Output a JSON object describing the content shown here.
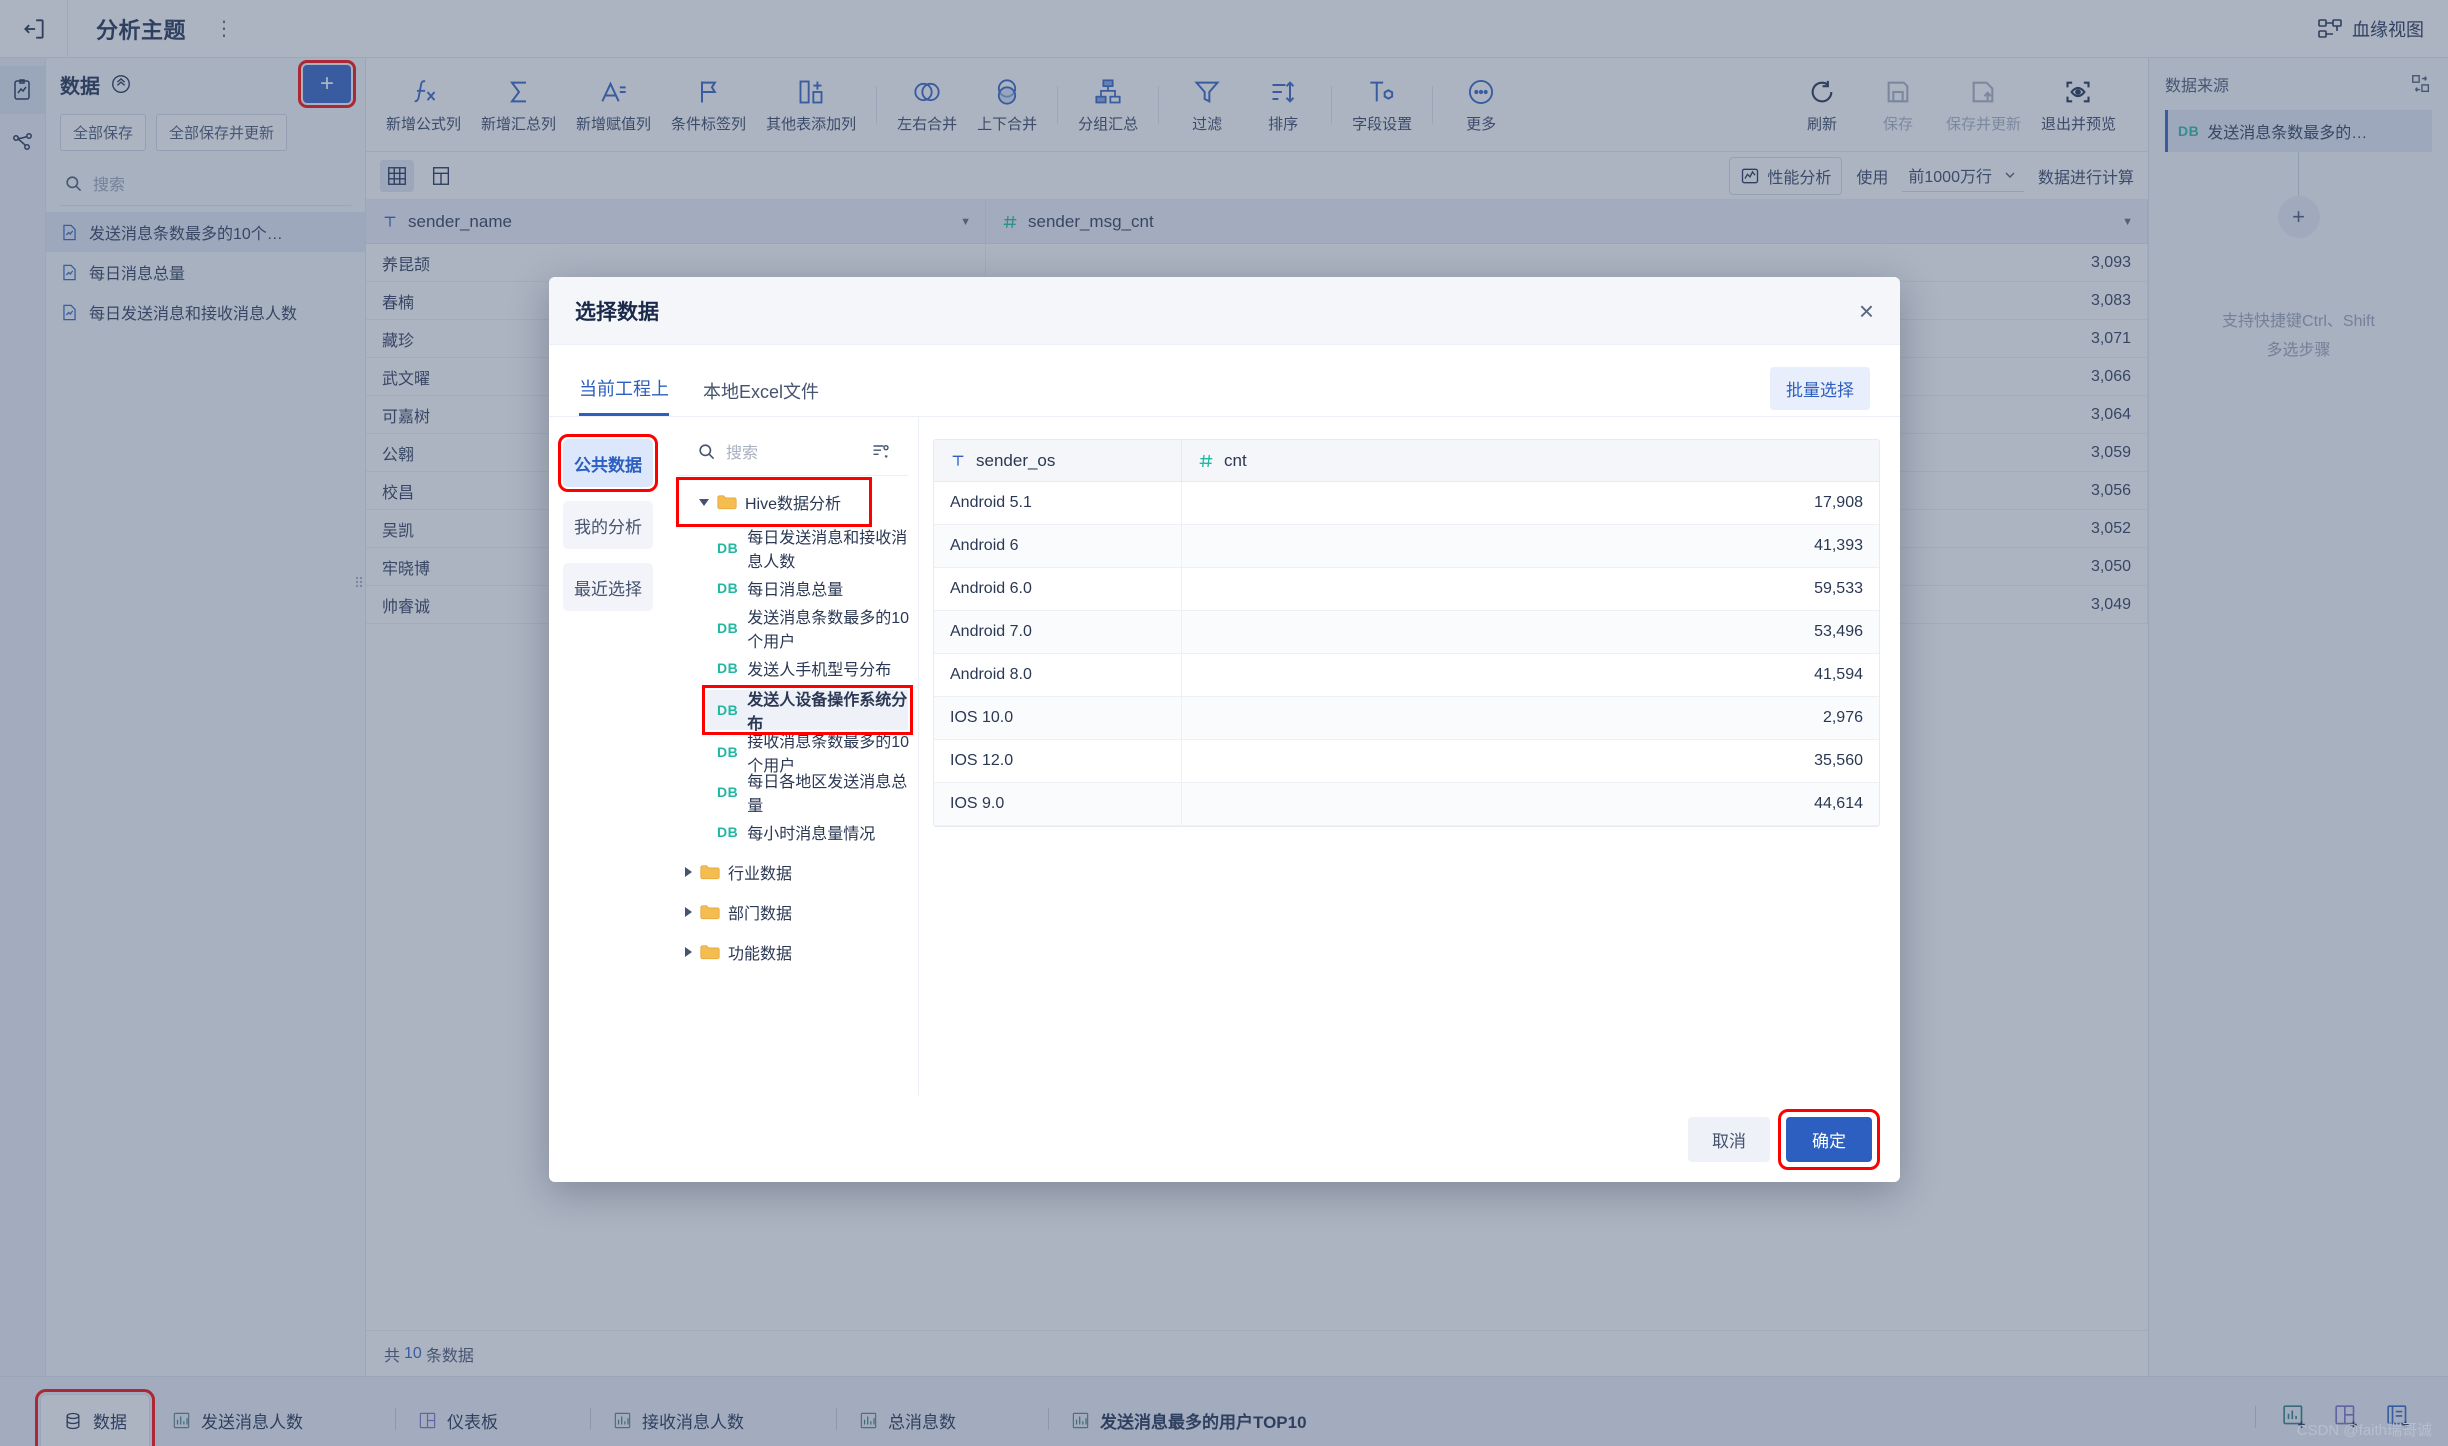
{
  "titlebar": {
    "back_icon": "exit-arrow-icon",
    "title": "分析主题",
    "more_icon": "vertical-dots-icon",
    "lineage_icon": "lineage-icon",
    "lineage_label": "血缘视图"
  },
  "rail": {
    "items": [
      {
        "name": "clipboard-analysis-icon",
        "active": true
      },
      {
        "name": "flow-nodes-icon",
        "active": false
      }
    ]
  },
  "left_panel": {
    "title": "数据",
    "collapse_icon": "collapse-up-icon",
    "add_label": "+",
    "buttons": [
      "全部保存",
      "全部保存并更新"
    ],
    "search_placeholder": "搜索",
    "items": [
      {
        "label": "发送消息条数最多的10个…",
        "active": true
      },
      {
        "label": "每日消息总量",
        "active": false
      },
      {
        "label": "每日发送消息和接收消息人数",
        "active": false
      }
    ]
  },
  "toolbar": {
    "groups": [
      [
        {
          "icon": "formula-column-icon",
          "label": "新增公式列"
        },
        {
          "icon": "sum-column-icon",
          "label": "新增汇总列"
        },
        {
          "icon": "assign-column-icon",
          "label": "新增赋值列"
        },
        {
          "icon": "condition-flag-icon",
          "label": "条件标签列"
        },
        {
          "icon": "other-table-column-icon",
          "label": "其他表添加列"
        }
      ],
      [
        {
          "icon": "merge-horizontal-icon",
          "label": "左右合并"
        },
        {
          "icon": "merge-vertical-icon",
          "label": "上下合并"
        }
      ],
      [
        {
          "icon": "group-aggregate-icon",
          "label": "分组汇总"
        }
      ],
      [
        {
          "icon": "filter-icon",
          "label": "过滤"
        },
        {
          "icon": "sort-icon",
          "label": "排序"
        }
      ],
      [
        {
          "icon": "field-settings-icon",
          "label": "字段设置"
        }
      ],
      [
        {
          "icon": "more-icon",
          "label": "更多"
        }
      ]
    ],
    "right_actions": [
      {
        "icon": "refresh-icon",
        "label": "刷新",
        "disabled": false
      },
      {
        "icon": "save-icon",
        "label": "保存",
        "disabled": true
      },
      {
        "icon": "save-update-icon",
        "label": "保存并更新",
        "disabled": true
      },
      {
        "icon": "exit-preview-icon",
        "label": "退出并预览",
        "disabled": false
      }
    ]
  },
  "subbar": {
    "view_grid_icon": "grid-view-icon",
    "view_split_icon": "split-view-icon",
    "perf_icon": "performance-icon",
    "perf_label": "性能分析",
    "use_label": "使用",
    "rows_value": "前1000万行",
    "rows_caret": "chevron-down-icon",
    "calc_label": "数据进行计算"
  },
  "grid": {
    "columns": [
      {
        "type_icon": "text-type-icon",
        "name": "sender_name"
      },
      {
        "type_icon": "number-type-icon",
        "name": "sender_msg_cnt"
      }
    ],
    "rows": [
      {
        "sender_name": "养昆颉",
        "sender_msg_cnt": "3,093"
      },
      {
        "sender_name": "春楠",
        "sender_msg_cnt": "3,083"
      },
      {
        "sender_name": "藏珍",
        "sender_msg_cnt": "3,071"
      },
      {
        "sender_name": "武文曜",
        "sender_msg_cnt": "3,066"
      },
      {
        "sender_name": "可嘉树",
        "sender_msg_cnt": "3,064"
      },
      {
        "sender_name": "公翱",
        "sender_msg_cnt": "3,059"
      },
      {
        "sender_name": "校昌",
        "sender_msg_cnt": "3,056"
      },
      {
        "sender_name": "吴凯",
        "sender_msg_cnt": "3,052"
      },
      {
        "sender_name": "牢晓博",
        "sender_msg_cnt": "3,050"
      },
      {
        "sender_name": "帅睿诚",
        "sender_msg_cnt": "3,049"
      }
    ],
    "footer_prefix": "共",
    "footer_count": "10",
    "footer_suffix": "条数据"
  },
  "right_panel": {
    "title": "数据来源",
    "expand_icon": "expand-diagram-icon",
    "source_label": "发送消息条数最多的…",
    "source_badge": "DB",
    "add_step_icon": "plus-circle-icon",
    "hint_line1": "支持快捷键Ctrl、Shift",
    "hint_line2": "多选步骤"
  },
  "bottom_bar": {
    "tabs": [
      {
        "icon": "database-icon",
        "label": "数据",
        "active": true,
        "highlight": true
      },
      {
        "icon": "chart-icon",
        "label": "发送消息人数",
        "active": false
      },
      {
        "icon": "dashboard-icon",
        "label": "仪表板",
        "active": false
      },
      {
        "icon": "chart-icon",
        "label": "接收消息人数",
        "active": false
      },
      {
        "icon": "chart-icon",
        "label": "总消息数",
        "active": false
      },
      {
        "icon": "chart-icon",
        "label": "发送消息最多的用户TOP10",
        "active": false
      }
    ],
    "add_buttons": [
      {
        "icon": "add-chart-icon"
      },
      {
        "icon": "add-dashboard-icon"
      },
      {
        "icon": "add-report-icon"
      }
    ]
  },
  "watermark": "CSDN @faith瑞哥诚",
  "modal": {
    "title": "选择数据",
    "close_icon": "close-icon",
    "tabs": [
      {
        "label": "当前工程上",
        "active": true
      },
      {
        "label": "本地Excel文件",
        "active": false
      }
    ],
    "batch_label": "批量选择",
    "categories": [
      {
        "label": "公共数据",
        "active": true,
        "highlight": true
      },
      {
        "label": "我的分析",
        "active": false
      },
      {
        "label": "最近选择",
        "active": false
      }
    ],
    "search_placeholder": "搜索",
    "filter_icon": "filter-list-icon",
    "tree": [
      {
        "label": "Hive数据分析",
        "type": "folder",
        "expanded": true,
        "highlight": true,
        "children": [
          {
            "label": "每日发送消息和接收消息人数",
            "badge": "DB"
          },
          {
            "label": "每日消息总量",
            "badge": "DB"
          },
          {
            "label": "发送消息条数最多的10个用户",
            "badge": "DB"
          },
          {
            "label": "发送人手机型号分布",
            "badge": "DB"
          },
          {
            "label": "发送人设备操作系统分布",
            "badge": "DB",
            "selected": true,
            "highlight": true
          },
          {
            "label": "接收消息条数最多的10个用户",
            "badge": "DB"
          },
          {
            "label": "每日各地区发送消息总量",
            "badge": "DB"
          },
          {
            "label": "每小时消息量情况",
            "badge": "DB"
          }
        ]
      },
      {
        "label": "行业数据",
        "type": "folder",
        "expanded": false
      },
      {
        "label": "部门数据",
        "type": "folder",
        "expanded": false
      },
      {
        "label": "功能数据",
        "type": "folder",
        "expanded": false
      }
    ],
    "preview": {
      "columns": [
        {
          "type_icon": "text-type-icon",
          "name": "sender_os"
        },
        {
          "type_icon": "number-type-icon",
          "name": "cnt"
        }
      ],
      "rows": [
        {
          "sender_os": "Android 5.1",
          "cnt": "17,908"
        },
        {
          "sender_os": "Android 6",
          "cnt": "41,393"
        },
        {
          "sender_os": "Android 6.0",
          "cnt": "59,533"
        },
        {
          "sender_os": "Android 7.0",
          "cnt": "53,496"
        },
        {
          "sender_os": "Android 8.0",
          "cnt": "41,594"
        },
        {
          "sender_os": "IOS 10.0",
          "cnt": "2,976"
        },
        {
          "sender_os": "IOS 12.0",
          "cnt": "35,560"
        },
        {
          "sender_os": "IOS 9.0",
          "cnt": "44,614"
        }
      ]
    },
    "cancel_label": "取消",
    "ok_label": "确定"
  },
  "colors": {
    "accent": "#2c5fc0",
    "highlight": "#ff0000",
    "db_badge": "#22b8a0",
    "text": "#2b3854"
  }
}
